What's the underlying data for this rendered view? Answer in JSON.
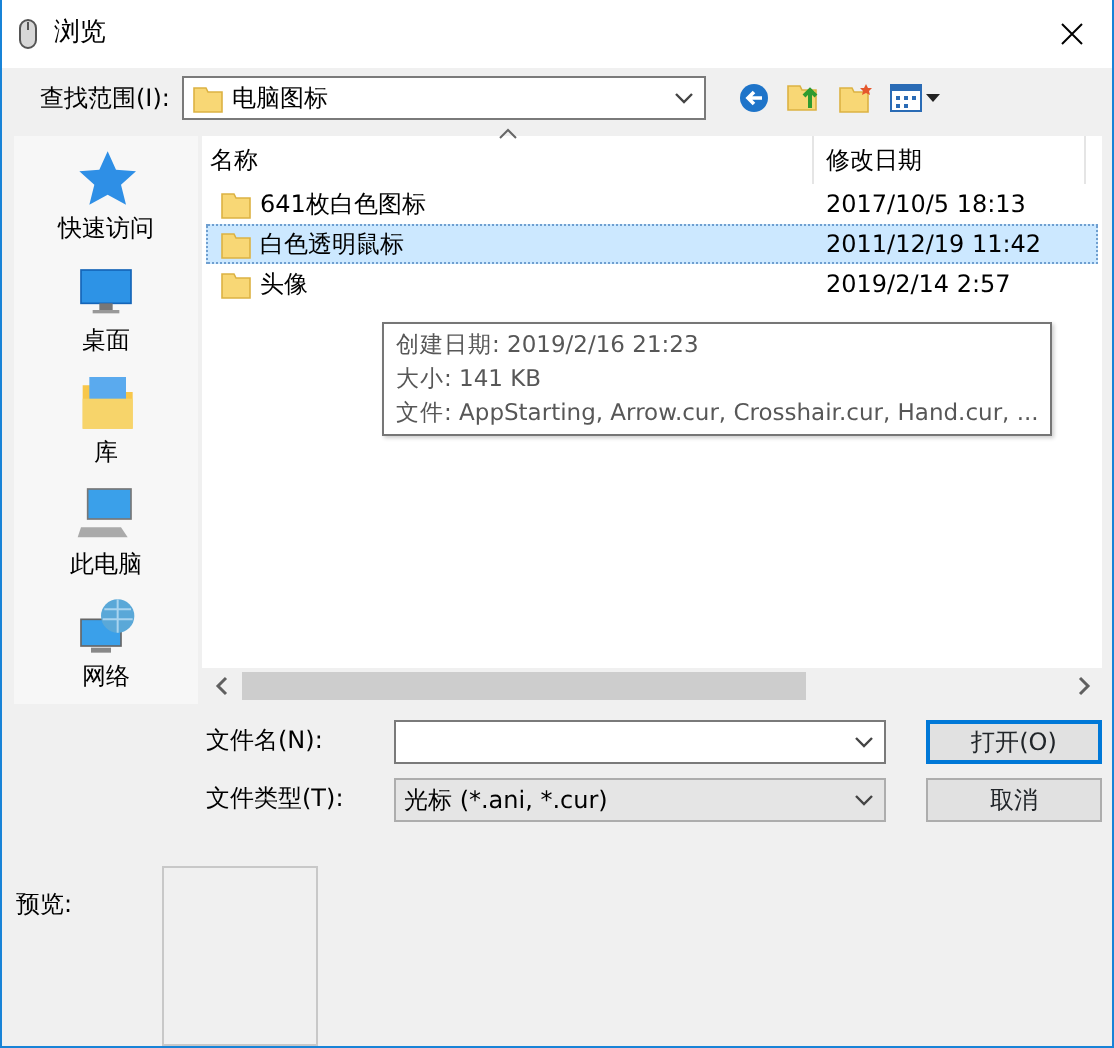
{
  "window": {
    "title": "浏览"
  },
  "look_in": {
    "label": "查找范围(I):",
    "value": "电脑图标"
  },
  "sidebar": {
    "items": [
      {
        "label": "快速访问",
        "kind": "star"
      },
      {
        "label": "桌面",
        "kind": "desktop"
      },
      {
        "label": "库",
        "kind": "library"
      },
      {
        "label": "此电脑",
        "kind": "computer"
      },
      {
        "label": "网络",
        "kind": "network"
      }
    ]
  },
  "file_list": {
    "columns": [
      "名称",
      "修改日期"
    ],
    "rows": [
      {
        "name": "641枚白色图标",
        "modified": "2017/10/5 18:13",
        "selected": false
      },
      {
        "name": "白色透明鼠标",
        "modified": "2011/12/19 11:42",
        "selected": true
      },
      {
        "name": "头像",
        "modified": "2019/2/14 2:57",
        "selected": false
      }
    ],
    "tooltip": [
      "创建日期: 2019/2/16 21:23",
      "大小: 141 KB",
      "文件: AppStarting, Arrow.cur, Crosshair.cur, Hand.cur, ..."
    ]
  },
  "file_name": {
    "label": "文件名(N):"
  },
  "file_type": {
    "label": "文件类型(T):",
    "value": "光标 (*.ani, *.cur)"
  },
  "buttons": [
    {
      "label": "打开(O)",
      "default": true
    },
    {
      "label": "取消",
      "default": false
    }
  ],
  "preview": {
    "label": "预览:"
  }
}
